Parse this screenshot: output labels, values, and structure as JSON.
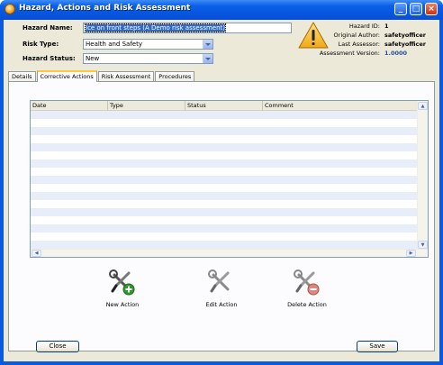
{
  "window": {
    "title": "Hazard, Actions and Risk Assessment",
    "minimize_glyph": "_",
    "maximize_glyph": "□",
    "close_glyph": "×"
  },
  "form": {
    "hazard_name_label": "Hazard Name:",
    "hazard_name_value": "Ice on front steps (A Demo risk assessment)",
    "risk_type_label": "Risk Type:",
    "risk_type_value": "Health and Safety",
    "hazard_status_label": "Hazard Status:",
    "hazard_status_value": "New"
  },
  "info": {
    "hazard_id_label": "Hazard ID:",
    "hazard_id_value": "1",
    "original_author_label": "Original Author:",
    "original_author_value": "safetyofficer",
    "last_assessor_label": "Last Assessor:",
    "last_assessor_value": "safetyofficer",
    "assessment_version_label": "Assessment Version:",
    "assessment_version_value": "1.0000",
    "version_color": "#1f4ea8"
  },
  "tabs": [
    {
      "label": "Details",
      "active": false
    },
    {
      "label": "Corrective Actions",
      "active": true
    },
    {
      "label": "Risk Assessment",
      "active": false
    },
    {
      "label": "Procedures",
      "active": false
    }
  ],
  "table": {
    "columns": [
      "Date",
      "Type",
      "Status",
      "Comment"
    ],
    "rows": []
  },
  "actions": {
    "new_label": "New Action",
    "edit_label": "Edit Action",
    "delete_label": "Delete Action"
  },
  "buttons": {
    "close_label": "Close",
    "save_label": "Save"
  },
  "colors": {
    "title_bar": "#0a5fe8",
    "dialog_bg": "#ece9d8",
    "tab_highlight": "#ffc73c",
    "add_green": "#2e9a2e",
    "delete_red": "#d04030"
  }
}
